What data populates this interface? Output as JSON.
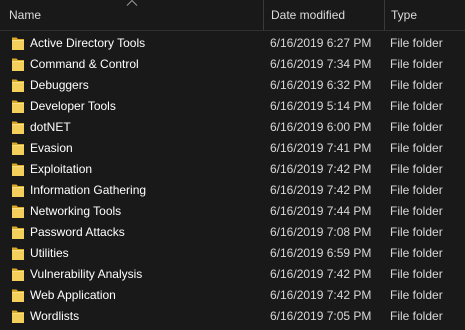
{
  "header": {
    "name_label": "Name",
    "date_label": "Date modified",
    "type_label": "Type",
    "sort_icon": "sort-ascending-icon"
  },
  "colors": {
    "background": "#191919",
    "folder": "#f2c94c",
    "text": "#ffffff"
  },
  "rows": [
    {
      "name": "Active Directory Tools",
      "date": "6/16/2019 6:27 PM",
      "type": "File folder",
      "icon": "folder-icon"
    },
    {
      "name": "Command & Control",
      "date": "6/16/2019 7:34 PM",
      "type": "File folder",
      "icon": "folder-icon"
    },
    {
      "name": "Debuggers",
      "date": "6/16/2019 6:32 PM",
      "type": "File folder",
      "icon": "folder-icon"
    },
    {
      "name": "Developer Tools",
      "date": "6/16/2019 5:14 PM",
      "type": "File folder",
      "icon": "folder-icon"
    },
    {
      "name": "dotNET",
      "date": "6/16/2019 6:00 PM",
      "type": "File folder",
      "icon": "folder-icon"
    },
    {
      "name": "Evasion",
      "date": "6/16/2019 7:41 PM",
      "type": "File folder",
      "icon": "folder-icon"
    },
    {
      "name": "Exploitation",
      "date": "6/16/2019 7:42 PM",
      "type": "File folder",
      "icon": "folder-icon"
    },
    {
      "name": "Information Gathering",
      "date": "6/16/2019 7:42 PM",
      "type": "File folder",
      "icon": "folder-icon"
    },
    {
      "name": "Networking Tools",
      "date": "6/16/2019 7:44 PM",
      "type": "File folder",
      "icon": "folder-icon"
    },
    {
      "name": "Password Attacks",
      "date": "6/16/2019 7:08 PM",
      "type": "File folder",
      "icon": "folder-icon"
    },
    {
      "name": "Utilities",
      "date": "6/16/2019 6:59 PM",
      "type": "File folder",
      "icon": "folder-icon"
    },
    {
      "name": "Vulnerability Analysis",
      "date": "6/16/2019 7:42 PM",
      "type": "File folder",
      "icon": "folder-icon"
    },
    {
      "name": "Web Application",
      "date": "6/16/2019 7:42 PM",
      "type": "File folder",
      "icon": "folder-icon"
    },
    {
      "name": "Wordlists",
      "date": "6/16/2019 7:05 PM",
      "type": "File folder",
      "icon": "folder-icon"
    }
  ]
}
